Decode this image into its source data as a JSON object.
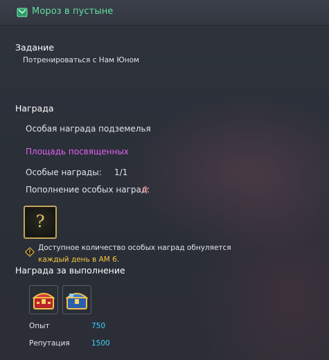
{
  "header": {
    "title": "Мороз в пустыне",
    "icon": "green-quest-icon"
  },
  "task": {
    "label": "Задание",
    "description": "Потренироваться с Нам Юном"
  },
  "reward": {
    "label": "Награда",
    "dungeon_reward": "Особая награда подземелья",
    "location": "Площадь посвященных",
    "special_label": "Особые награды:",
    "special_value": "1/1",
    "refill_label": "Пополнение особых наград:",
    "refill_value": "0",
    "unknown_item_glyph": "?",
    "notice_line1": "Доступное количество особых наград обнуляется",
    "notice_line2": "каждый день в AM 6."
  },
  "completion": {
    "label": "Награда за выполнение",
    "items": [
      "red-gold-chest-icon",
      "blue-gold-chest-icon"
    ],
    "exp_label": "Опыт",
    "exp_value": "750",
    "rep_label": "Репутация",
    "rep_value": "1500"
  },
  "colors": {
    "title_green": "#62e0a3",
    "purple_link": "#df63f2",
    "warning_yellow": "#f5c743",
    "value_cyan": "#3fd0ff",
    "zero_red": "#ef6b6b"
  }
}
